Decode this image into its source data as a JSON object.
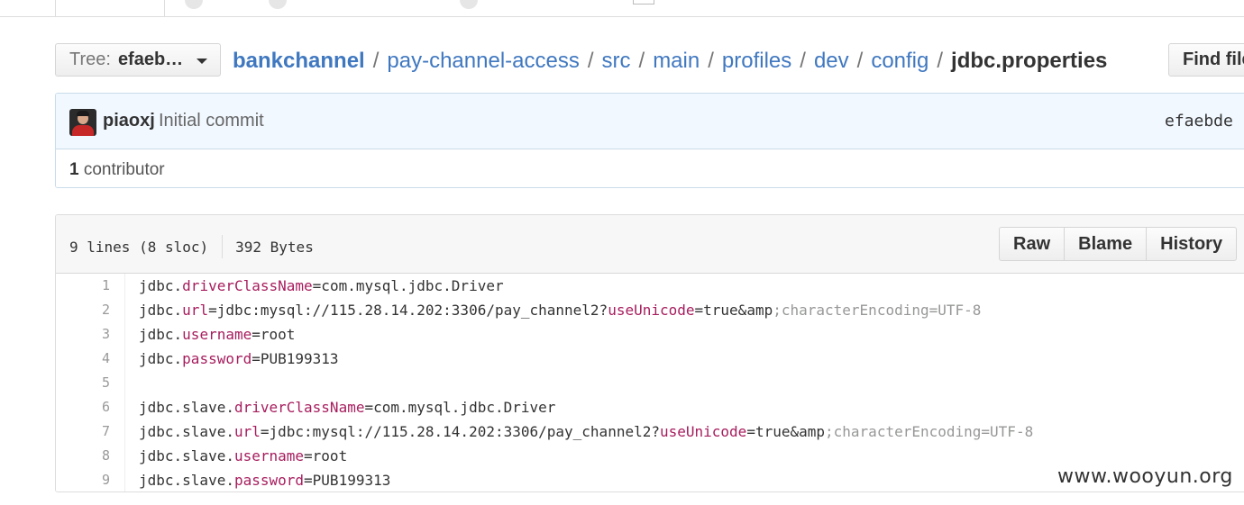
{
  "breadcrumb": {
    "tree_label": "Tree:",
    "tree_value": "efaeb…",
    "repo": "bankchannel",
    "path": [
      "pay-channel-access",
      "src",
      "main",
      "profiles",
      "dev",
      "config"
    ],
    "separator": "/",
    "file": "jdbc.properties",
    "find_file_label": "Find file"
  },
  "commit": {
    "author": "piaoxj",
    "message": "Initial commit",
    "sha": "efaebde c",
    "contributor_count": "1",
    "contributor_label": " contributor"
  },
  "file": {
    "lines_info": "9 lines (8 sloc)",
    "size": "392 Bytes",
    "buttons": {
      "raw": "Raw",
      "blame": "Blame",
      "history": "History"
    }
  },
  "code_lines": [
    {
      "n": "1",
      "tokens": [
        {
          "t": "jdbc.",
          "c": ""
        },
        {
          "t": "driverClassName",
          "c": "k"
        },
        {
          "t": "=com.mysql.jdbc.Driver",
          "c": ""
        }
      ]
    },
    {
      "n": "2",
      "tokens": [
        {
          "t": "jdbc.",
          "c": ""
        },
        {
          "t": "url",
          "c": "k"
        },
        {
          "t": "=jdbc:mysql://115.28.14.202:3306/pay_channel2?",
          "c": ""
        },
        {
          "t": "useUnicode",
          "c": "k"
        },
        {
          "t": "=true&amp",
          "c": ""
        },
        {
          "t": ";characterEncoding=UTF-8",
          "c": "c"
        }
      ]
    },
    {
      "n": "3",
      "tokens": [
        {
          "t": "jdbc.",
          "c": ""
        },
        {
          "t": "username",
          "c": "k"
        },
        {
          "t": "=root",
          "c": ""
        }
      ]
    },
    {
      "n": "4",
      "tokens": [
        {
          "t": "jdbc.",
          "c": ""
        },
        {
          "t": "password",
          "c": "k"
        },
        {
          "t": "=PUB199313",
          "c": ""
        }
      ]
    },
    {
      "n": "5",
      "tokens": []
    },
    {
      "n": "6",
      "tokens": [
        {
          "t": "jdbc.slave.",
          "c": ""
        },
        {
          "t": "driverClassName",
          "c": "k"
        },
        {
          "t": "=com.mysql.jdbc.Driver",
          "c": ""
        }
      ]
    },
    {
      "n": "7",
      "tokens": [
        {
          "t": "jdbc.slave.",
          "c": ""
        },
        {
          "t": "url",
          "c": "k"
        },
        {
          "t": "=jdbc:mysql://115.28.14.202:3306/pay_channel2?",
          "c": ""
        },
        {
          "t": "useUnicode",
          "c": "k"
        },
        {
          "t": "=true&amp",
          "c": ""
        },
        {
          "t": ";characterEncoding=UTF-8",
          "c": "c"
        }
      ]
    },
    {
      "n": "8",
      "tokens": [
        {
          "t": "jdbc.slave.",
          "c": ""
        },
        {
          "t": "username",
          "c": "k"
        },
        {
          "t": "=root",
          "c": ""
        }
      ]
    },
    {
      "n": "9",
      "tokens": [
        {
          "t": "jdbc.slave.",
          "c": ""
        },
        {
          "t": "password",
          "c": "k"
        },
        {
          "t": "=PUB199313",
          "c": ""
        }
      ]
    }
  ],
  "watermark": "www.wooyun.org",
  "colors": {
    "link": "#4078c0",
    "keyword": "#a71d5d",
    "comment": "#969896",
    "commit_bg": "#f1f8ff"
  }
}
